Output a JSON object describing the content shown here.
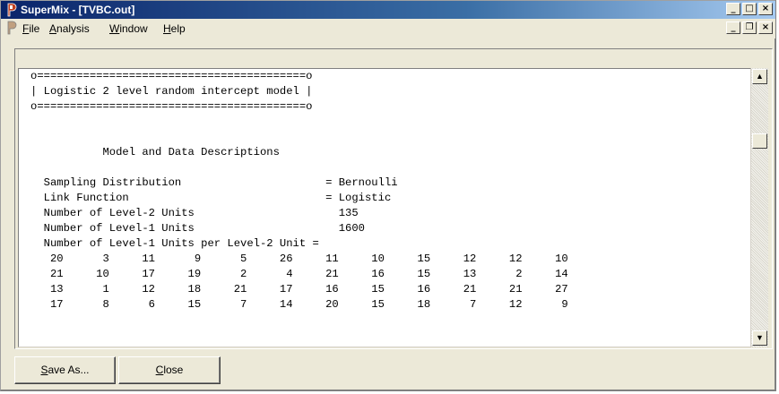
{
  "window": {
    "title": "SuperMix - [TVBC.out]",
    "controls": {
      "minimize": "_",
      "maximize": "□",
      "close": "×"
    },
    "mdi_controls": {
      "minimize": "_",
      "restore": "❐",
      "close": "×"
    }
  },
  "menu": {
    "items": [
      {
        "label": "File",
        "underline": "F",
        "rest": "ile"
      },
      {
        "label": "Analysis",
        "underline": "A",
        "rest": "nalysis"
      },
      {
        "label": "Window",
        "underline": "W",
        "rest": "indow"
      },
      {
        "label": "Help",
        "underline": "H",
        "rest": "elp"
      }
    ]
  },
  "output": {
    "lines": [
      "o=========================================o",
      "| Logistic 2 level random intercept model |",
      "o=========================================o",
      "",
      "",
      "           Model and Data Descriptions",
      "",
      "  Sampling Distribution                      = Bernoulli",
      "  Link Function                              = Logistic",
      "  Number of Level-2 Units                      135",
      "  Number of Level-1 Units                      1600",
      "  Number of Level-1 Units per Level-2 Unit =",
      "   20      3     11      9      5     26     11     10     15     12     12     10",
      "   21     10     17     19      2      4     21     16     15     13      2     14",
      "   13      1     12     18     21     17     16     15     16     21     21     27",
      "   17      8      6     15      7     14     20     15     18      7     12      9"
    ]
  },
  "scrollbar": {
    "up_arrow": "▲",
    "down_arrow": "▼"
  },
  "buttons": {
    "save_as": {
      "underline": "S",
      "rest": "ave As..."
    },
    "close": {
      "underline": "C",
      "rest": "lose"
    }
  }
}
